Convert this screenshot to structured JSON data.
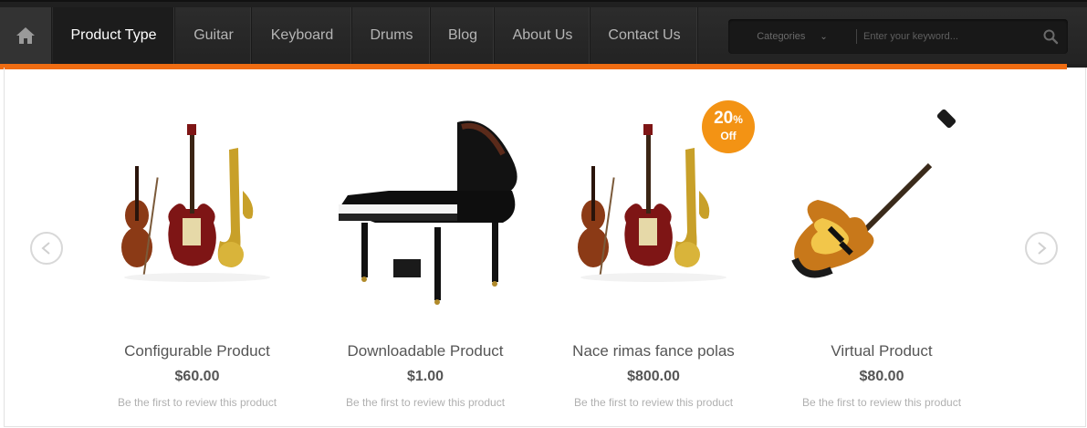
{
  "nav": {
    "home_icon": "home-icon",
    "items": [
      {
        "label": "Product Type",
        "active": true
      },
      {
        "label": "Guitar"
      },
      {
        "label": "Keyboard"
      },
      {
        "label": "Drums"
      },
      {
        "label": "Blog"
      },
      {
        "label": "About Us"
      },
      {
        "label": "Contact Us"
      }
    ],
    "accent_color": "#ef6c12"
  },
  "search": {
    "category_label": "Categories",
    "placeholder": "Enter your keyword...",
    "button_icon": "search-icon"
  },
  "carousel": {
    "prev_icon": "chevron-left-icon",
    "next_icon": "chevron-right-icon",
    "products": [
      {
        "name": "Configurable Product",
        "price": "$60.00",
        "review": "Be the first to review this product",
        "image": "instruments-image"
      },
      {
        "name": "Downloadable Product",
        "price": "$1.00",
        "review": "Be the first to review this product",
        "image": "grand-piano-image"
      },
      {
        "name": "Nace rimas fance polas",
        "price": "$800.00",
        "review": "Be the first to review this product",
        "image": "instruments-image",
        "badge": {
          "value": "20",
          "unit": "%",
          "text": "Off",
          "color": "#f39314"
        }
      },
      {
        "name": "Virtual Product",
        "price": "$80.00",
        "review": "Be the first to review this product",
        "image": "bass-guitar-image"
      }
    ]
  }
}
